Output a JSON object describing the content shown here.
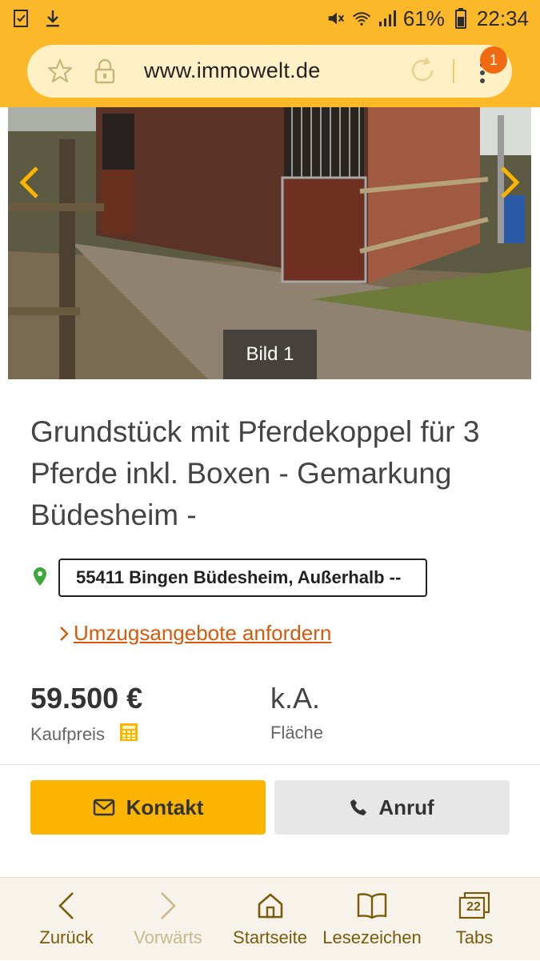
{
  "status_bar": {
    "battery": "61%",
    "time": "22:34",
    "icons": [
      "download-done-icon",
      "download-icon",
      "mute-icon",
      "wifi-icon",
      "signal-icon",
      "battery-icon"
    ]
  },
  "browser": {
    "url": "www.immowelt.de",
    "tab_badge": "1"
  },
  "listing": {
    "image_caption": "Bild 1",
    "title": "Grundstück mit Pferdekoppel für 3 Pferde inkl. Boxen - Gemarkung Büdesheim -",
    "location": "55411 Bingen Büdesheim, Außerhalb --",
    "moving_link": "Umzugsangebote anfordern",
    "price": "59.500 €",
    "price_label": "Kaufpreis",
    "area": "k.A.",
    "area_label": "Fläche",
    "contact_button": "Kontakt",
    "call_button": "Anruf"
  },
  "bottom_nav": {
    "back": "Zurück",
    "forward": "Vorwärts",
    "home": "Startseite",
    "bookmarks": "Lesezeichen",
    "tabs": "Tabs",
    "tabs_count": "22"
  },
  "colors": {
    "brand_yellow": "#fbb829",
    "button_yellow": "#fbb400",
    "link_orange": "#d55a0a",
    "badge_orange": "#f06a12",
    "pin_green": "#3aa83a"
  }
}
